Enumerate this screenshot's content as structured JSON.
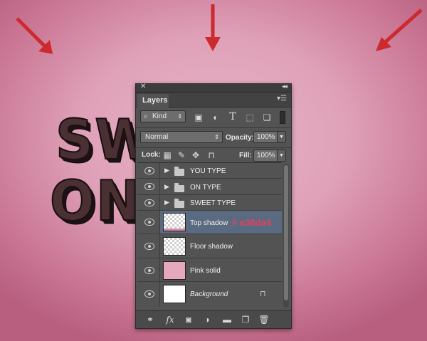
{
  "artwork": {
    "line1": "SWEET",
    "line2": "ON YOU",
    "annotation": "# e38da4"
  },
  "panel": {
    "close_icon": "close-icon",
    "collapse_icon": "double-chevron-icon",
    "tab_label": "Layers",
    "menu_icon": "panel-menu-icon",
    "filter": {
      "kind_label": "Kind",
      "icons": [
        "image-filter-icon",
        "adjustment-filter-icon",
        "type-filter-icon",
        "shape-filter-icon",
        "smart-object-filter-icon"
      ]
    },
    "blend_mode": "Normal",
    "opacity_label": "Opacity:",
    "opacity_value": "100%",
    "lock_label": "Lock:",
    "fill_label": "Fill:",
    "fill_value": "100%",
    "layers": [
      {
        "name": "YOU TYPE",
        "type": "group"
      },
      {
        "name": "ON TYPE",
        "type": "group"
      },
      {
        "name": "SWEET TYPE",
        "type": "group"
      },
      {
        "name": "Top shadow",
        "type": "layer",
        "selected": true
      },
      {
        "name": "Floor shadow",
        "type": "layer"
      },
      {
        "name": "Pink solid",
        "type": "layer",
        "fill": "#e6a8bd"
      },
      {
        "name": "Background",
        "type": "background",
        "locked": true
      }
    ],
    "footer_icons": [
      "link-icon",
      "fx-icon",
      "mask-icon",
      "adjustment-icon",
      "folder-icon",
      "new-layer-icon",
      "trash-icon"
    ]
  },
  "colors": {
    "accent_hex": "#e2405f",
    "selection": "#5a6a80",
    "arrow": "#cc2a2e"
  }
}
